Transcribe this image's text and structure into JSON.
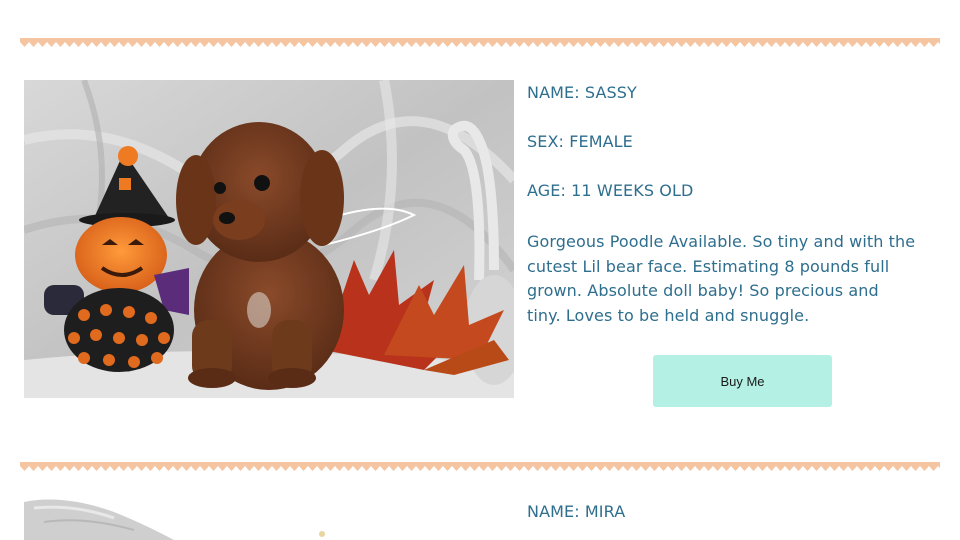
{
  "listings": [
    {
      "name": "NAME: SASSY",
      "sex": "SEX: FEMALE",
      "age": "AGE: 11 WEEKS OLD",
      "description": "Gorgeous Poodle Available. So tiny and with the cutest Lil bear face. Estimating 8 pounds full grown. Absolute doll baby! So precious and tiny. Loves to be held and snuggle.",
      "buy_label": "Buy Me"
    },
    {
      "name": "NAME: MIRA"
    }
  ],
  "colors": {
    "text": "#2e6e8e",
    "divider": "#f5c4a0",
    "button_bg": "#b4f0e4"
  },
  "icons": [
    "scalloped-divider"
  ]
}
